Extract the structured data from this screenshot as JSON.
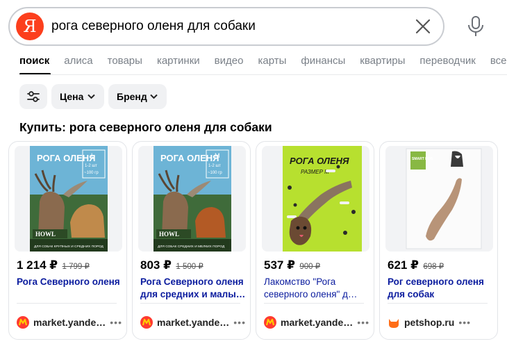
{
  "search": {
    "logo_letter": "Я",
    "query": "рога северного оленя для собаки"
  },
  "tabs": [
    {
      "label": "поиск",
      "active": true
    },
    {
      "label": "алиса"
    },
    {
      "label": "товары"
    },
    {
      "label": "картинки"
    },
    {
      "label": "видео"
    },
    {
      "label": "карты"
    },
    {
      "label": "финансы"
    },
    {
      "label": "квартиры"
    },
    {
      "label": "переводчик"
    },
    {
      "label": "все"
    }
  ],
  "filters": {
    "price_label": "Цена",
    "brand_label": "Бренд"
  },
  "section_title": "Купить: рога северного оленя для собаки",
  "products": [
    {
      "price": "1 214 ₽",
      "old_price": "1 799 ₽",
      "title": "Рога Северного оленя",
      "title_extra": "",
      "seller": "market.yande…",
      "image": {
        "brand_title": "РОГА ОЛЕНЯ",
        "size": "L",
        "pieces": "1-2 шт",
        "weight": "~100 гр",
        "logo": "HOWL",
        "caption": "ДЛЯ СОБАК КРУПНЫХ И СРЕДНИХ ПОРОД"
      }
    },
    {
      "price": "803 ₽",
      "old_price": "1 500 ₽",
      "title": "Рога Северного оленя",
      "title_extra": "для средних и малы…",
      "seller": "market.yande…",
      "image": {
        "brand_title": "РОГА ОЛЕНЯ",
        "size": "M",
        "pieces": "1-2 шт",
        "weight": "~100 гр",
        "logo": "HOWL",
        "caption": "ДЛЯ СОБАК СРЕДНИХ И МЕЛКИХ ПОРОД"
      }
    },
    {
      "price": "537 ₽",
      "old_price": "900 ₽",
      "title": "Лакомство \"Рога северного оленя\" д…",
      "title_extra": "",
      "seller": "market.yande…",
      "image": {
        "brand_title": "РОГА ОЛЕНЯ",
        "size": "РАЗМЕР М"
      }
    },
    {
      "price": "621 ₽",
      "old_price": "698 ₽",
      "title": "Рог северного оленя для собак",
      "title_extra": "",
      "seller": "petshop.ru",
      "image": {
        "brand_title": "SMART DOG"
      }
    }
  ],
  "more_label": "•••",
  "colors": {
    "yandex_red": "#fc3f1d",
    "link_blue": "#0a1b9e",
    "market_red": "#ff3b30",
    "market_yellow": "#ffcc00",
    "petshop_orange": "#ff6d17",
    "lime_pack": "#b7e02f"
  }
}
